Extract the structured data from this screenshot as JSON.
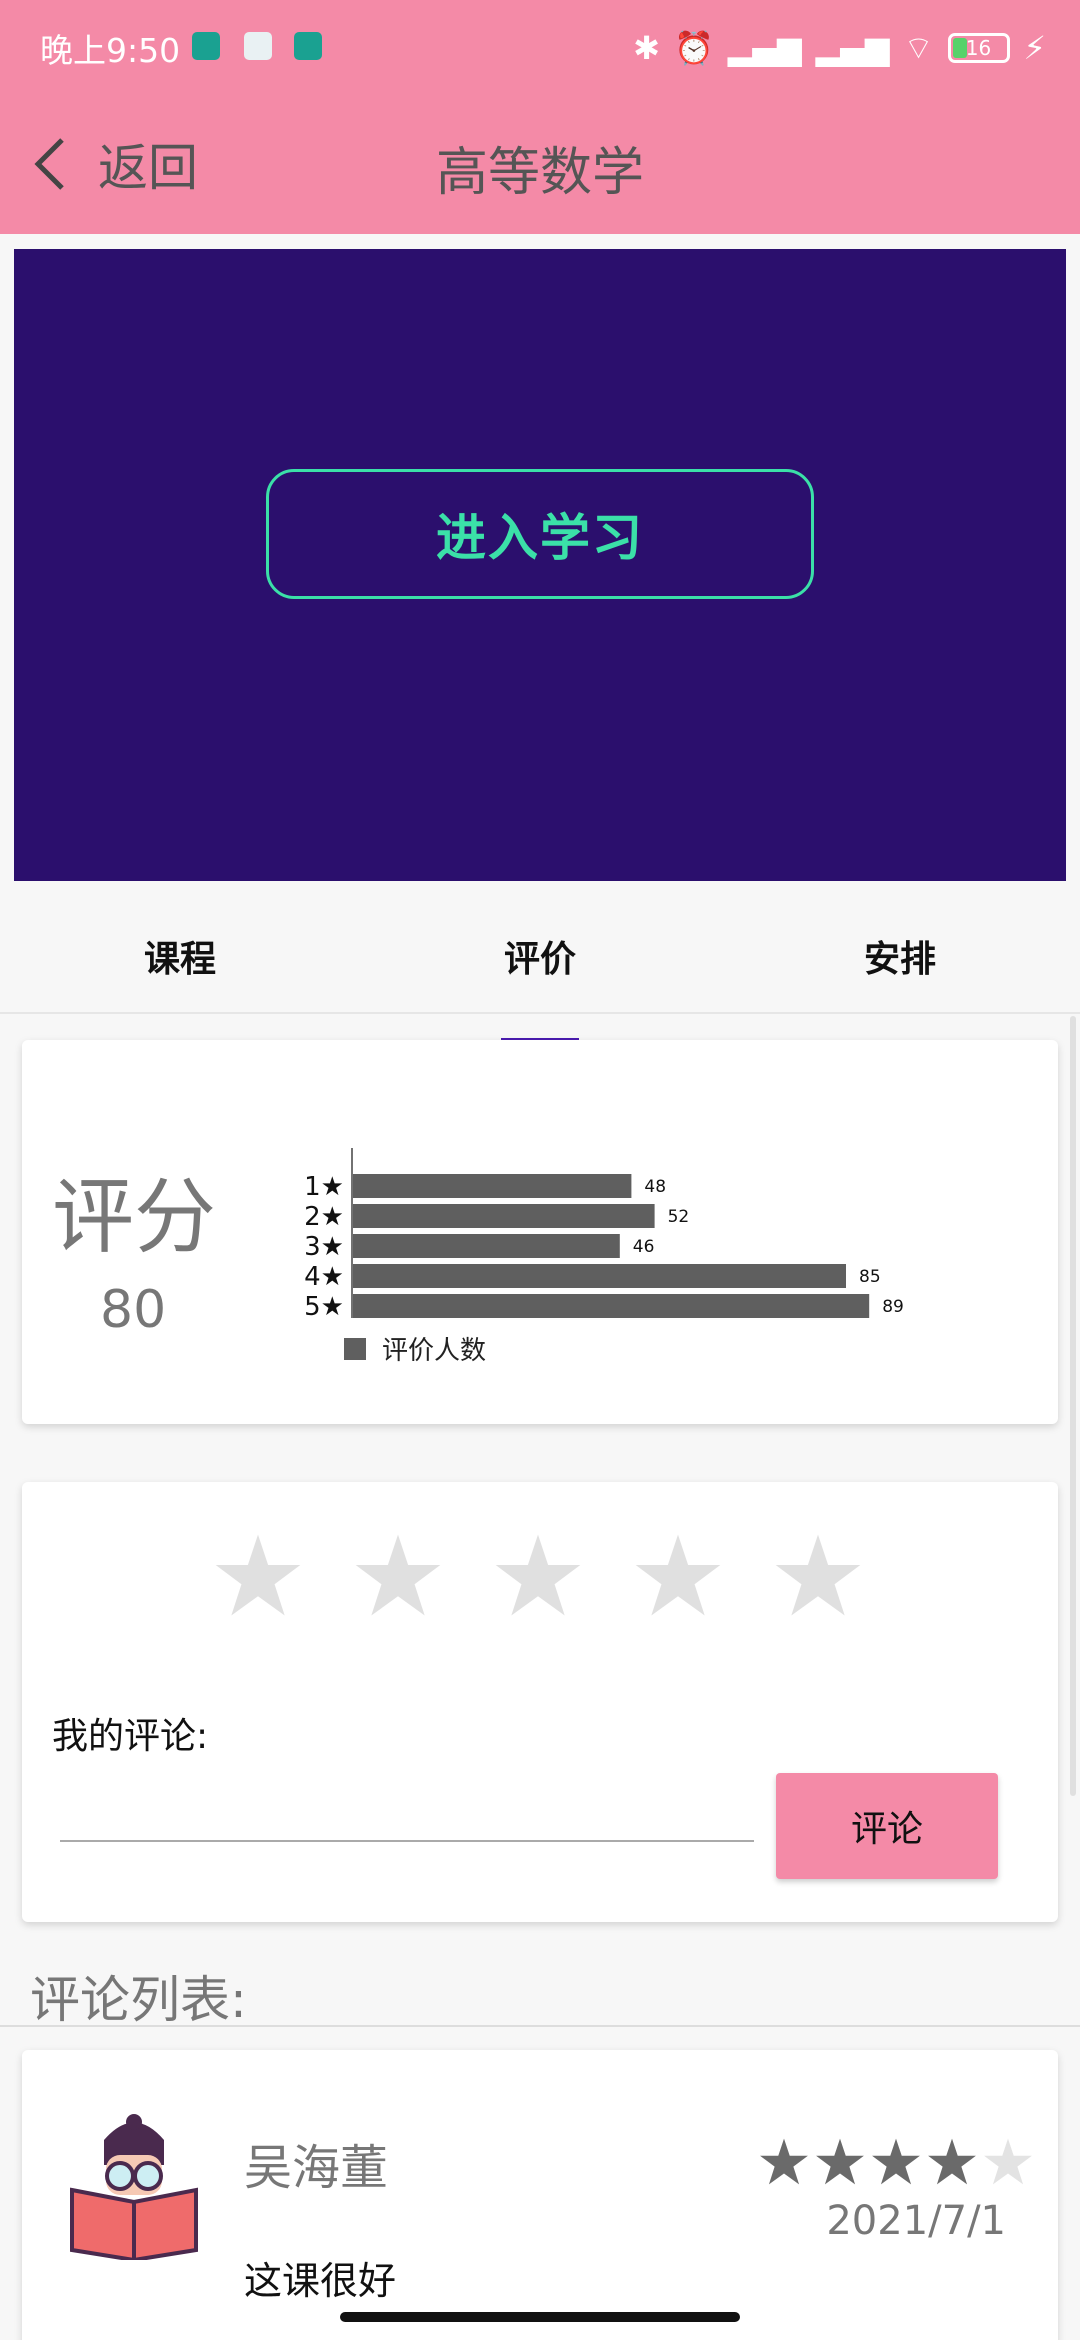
{
  "status_bar": {
    "time": "晚上9:50",
    "battery": "16"
  },
  "app_bar": {
    "back_label": "返回",
    "title": "高等数学"
  },
  "hero": {
    "enter_label": "进入学习"
  },
  "tabs": [
    {
      "label": "课程",
      "active": false
    },
    {
      "label": "评价",
      "active": true
    },
    {
      "label": "安排",
      "active": false
    }
  ],
  "score": {
    "label": "评分",
    "value": "80"
  },
  "chart_data": {
    "type": "bar",
    "orientation": "horizontal",
    "categories": [
      "1★",
      "2★",
      "3★",
      "4★",
      "5★"
    ],
    "series": [
      {
        "name": "评价人数",
        "values": [
          48,
          52,
          46,
          85,
          89
        ]
      }
    ],
    "xlim": [
      0,
      100
    ],
    "legend": "bottom-left",
    "grid": false,
    "colors": {
      "bar": "#5f5f5f"
    }
  },
  "rating_form": {
    "stars_selected": 0,
    "my_comment_label": "我的评论:",
    "input_value": "",
    "submit_label": "评论"
  },
  "comment_list": {
    "title": "评论列表:",
    "items": [
      {
        "name": "吴海董",
        "rating": 4,
        "date": "2021/7/1",
        "text": "这课很好"
      }
    ]
  },
  "colors": {
    "primary": "#f48aa7",
    "hero_bg": "#2b0f6d",
    "accent_green": "#3be0a8",
    "tab_indicator": "#4a1bb0"
  }
}
